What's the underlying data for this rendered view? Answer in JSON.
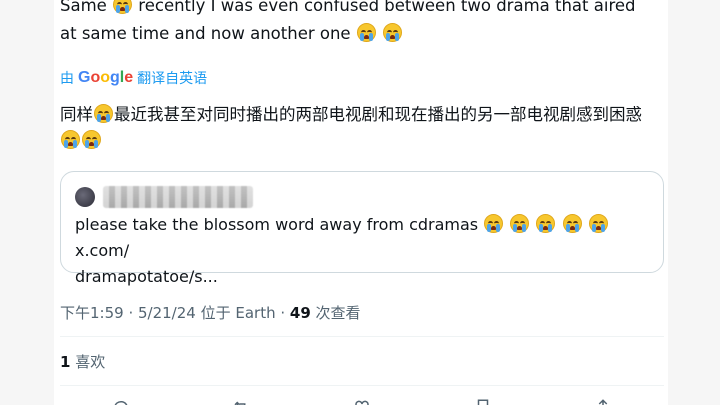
{
  "tweet": {
    "line1_a": "Same ",
    "line1_b": " recently I was even confused between two drama that aired",
    "line2": "at same time and now another one "
  },
  "translate": {
    "prefix": "由",
    "brand_letters": [
      "G",
      "o",
      "o",
      "g",
      "l",
      "e"
    ],
    "label": "翻译自英语"
  },
  "translated": {
    "part_a": "同样",
    "part_b": "最近我甚至对同时播出的两部电视剧和现在播出的另一部电视剧感到困惑"
  },
  "quote": {
    "text": "please take the blossom word away from cdramas ",
    "link1": " x.com/",
    "link2": "dramapotatoe/s..."
  },
  "meta": {
    "time": "下午1:59",
    "sep1": " · ",
    "date": "5/21/24",
    "location": " 位于 Earth · ",
    "views": "49",
    "views_label": " 次查看"
  },
  "likes": {
    "count": "1",
    "label": " 喜欢"
  },
  "colors": {
    "accent": "#1d9bf0",
    "secondary_text": "#536471",
    "border": "#cfd9de"
  },
  "icons": [
    "crying-emoji-icon",
    "reply-icon",
    "retweet-icon",
    "like-icon",
    "bookmark-icon",
    "share-icon"
  ]
}
